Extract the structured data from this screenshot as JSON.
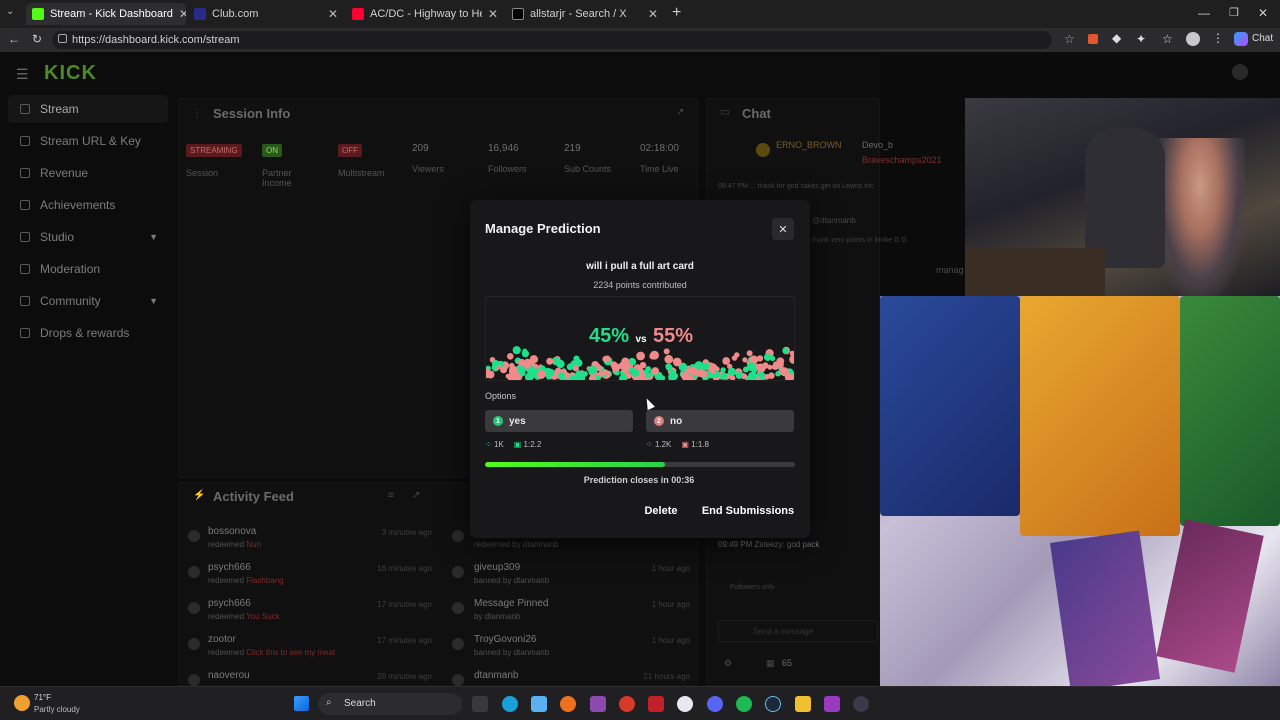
{
  "browser": {
    "tabs": [
      {
        "title": "Stream - Kick Dashboard",
        "color": "#53fc18"
      },
      {
        "title": "Club.com",
        "color": "#2a2a8a"
      },
      {
        "title": "AC/DC - Highway to Hell (Official",
        "color": "#ff0033"
      },
      {
        "title": "allstarjr - Search / X",
        "color": "#ffffff"
      }
    ],
    "url": "https://dashboard.kick.com/stream"
  },
  "dashboard": {
    "logo": "KICK",
    "nav": [
      {
        "label": "Stream",
        "icon": "broadcast-icon"
      },
      {
        "label": "Stream URL & Key",
        "icon": "link-icon"
      },
      {
        "label": "Revenue",
        "icon": "revenue-icon"
      },
      {
        "label": "Achievements",
        "icon": "trophy-icon"
      },
      {
        "label": "Studio",
        "icon": "studio-icon"
      },
      {
        "label": "Moderation",
        "icon": "shield-icon"
      },
      {
        "label": "Community",
        "icon": "community-icon"
      },
      {
        "label": "Drops & rewards",
        "icon": "gift-icon"
      }
    ],
    "session_info": {
      "title": "Session Info",
      "badges": [
        {
          "text": "STREAMING",
          "label": "Session",
          "color": "#c8202a"
        },
        {
          "text": "ON",
          "label": "Partner Income",
          "color": "#53fc18"
        },
        {
          "text": "OFF",
          "label": "Multistream",
          "color": "#c8202a"
        }
      ],
      "stats": [
        {
          "value": "209",
          "label": "Viewers"
        },
        {
          "value": "16,946",
          "label": "Followers"
        },
        {
          "value": "219",
          "label": "Sub Counts"
        },
        {
          "value": "02:18:00",
          "label": "Time Live"
        }
      ]
    },
    "chat": {
      "title": "Chat",
      "users": [
        "ERNO_BROWN",
        "Devo_b",
        "Braveschamps2021"
      ],
      "lines": [
        "09:47 PM ... thank for god sakes get on Lewns etc",
        "@dtanmanb",
        "thank zero points in broke G G",
        "manag",
        "09:49 PM Zsteezy: god pack",
        "Followers only"
      ],
      "input_placeholder": "Send a message",
      "viewer_count": "65"
    },
    "activity_feed": {
      "title": "Activity Feed",
      "left": [
        {
          "name": "bossonova",
          "action": "redeemed",
          "reward": "Nun",
          "time": "3 minutes ago"
        },
        {
          "name": "psych666",
          "action": "redeemed",
          "reward": "Flashbang",
          "time": "16 minutes ago"
        },
        {
          "name": "psych666",
          "action": "redeemed",
          "reward": "You Suck",
          "time": "17 minutes ago"
        },
        {
          "name": "zootor",
          "action": "redeemed",
          "reward": "Click this to see my meat",
          "time": "17 minutes ago"
        },
        {
          "name": "naoverou",
          "action": "",
          "reward": "",
          "time": "20 minutes ago"
        }
      ],
      "right": [
        {
          "name": "",
          "sub": "redeemed by dtanmanb",
          "time": ""
        },
        {
          "name": "giveup309",
          "sub": "banned by dtanmanb",
          "time": "1 hour ago"
        },
        {
          "name": "Message Pinned",
          "sub": "by dtanmanb",
          "time": "1 hour ago"
        },
        {
          "name": "TroyGovoni26",
          "sub": "banned by dtanmanb",
          "time": "1 hour ago"
        },
        {
          "name": "dtanmanb",
          "sub": "",
          "time": "21 hours ago"
        }
      ]
    }
  },
  "modal": {
    "title": "Manage Prediction",
    "question": "will i pull a full art card",
    "points": "2234 points contributed",
    "pct_yes": "45%",
    "pct_no": "55%",
    "vs": "vs",
    "yes_fraction": 0.45,
    "colors": {
      "yes": "#1fe08a",
      "no": "#f08a8a",
      "progress": "#53fc18"
    },
    "options_label": "Options",
    "options": [
      {
        "num": "1",
        "label": "yes",
        "users": "1K",
        "ratio": "1:2.2"
      },
      {
        "num": "2",
        "label": "no",
        "users": "1.2K",
        "ratio": "1:1.8"
      }
    ],
    "timer_fraction": 0.58,
    "closes_text": "Prediction closes in 00:36",
    "delete_label": "Delete",
    "end_label": "End Submissions"
  },
  "taskbar": {
    "weather_temp": "71°F",
    "weather_desc": "Partly cloudy",
    "search": "Search"
  }
}
